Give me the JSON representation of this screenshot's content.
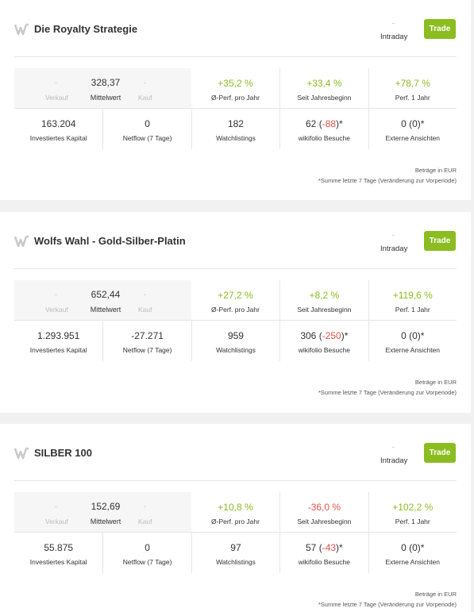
{
  "colors": {
    "accent": "#8bbc20",
    "negative": "#e0514e",
    "background": "#f1f1f1"
  },
  "icons": {
    "logo": "wikifolio-w-icon"
  },
  "cards": [
    {
      "name": "Die Royalty Strategie",
      "intraday_value": "-",
      "intraday_label": "Intraday",
      "trade_label": "Trade",
      "verkauf_value": "-",
      "verkauf_label": "Verkauf",
      "mittelwert_value": "328,37",
      "mittelwert_label": "Mittelwert",
      "kauf_value": "-",
      "kauf_label": "Kauf",
      "perf_year_value": "+35,2 %",
      "perf_year_label": "Ø-Perf. pro Jahr",
      "ytd_value": "+33,4 %",
      "ytd_label": "Seit Jahresbeginn",
      "perf1_value": "+78,7 %",
      "perf1_label": "Perf. 1 Jahr",
      "kapital_value": "163.204",
      "kapital_label": "Investiertes Kapital",
      "netflow_value": "0",
      "netflow_label": "Netflow (7 Tage)",
      "watch_value": "182",
      "watch_label": "Watchlistings",
      "besuche_value": "62",
      "besuche_change": "-88",
      "besuche_label": "wikifolio Besuche",
      "extern_value": "0",
      "extern_change": "0",
      "extern_label": "Externe Ansichten",
      "note1": "Beträge in EUR",
      "note2": "*Summe letzte 7 Tage (Veränderung zur Vorperiode)"
    },
    {
      "name": "Wolfs Wahl - Gold-Silber-Platin",
      "intraday_value": "-",
      "intraday_label": "Intraday",
      "trade_label": "Trade",
      "verkauf_value": "-",
      "verkauf_label": "Verkauf",
      "mittelwert_value": "652,44",
      "mittelwert_label": "Mittelwert",
      "kauf_value": "-",
      "kauf_label": "Kauf",
      "perf_year_value": "+27,2 %",
      "perf_year_label": "Ø-Perf. pro Jahr",
      "ytd_value": "+8,2 %",
      "ytd_label": "Seit Jahresbeginn",
      "perf1_value": "+119,6 %",
      "perf1_label": "Perf. 1 Jahr",
      "kapital_value": "1.293.951",
      "kapital_label": "Investiertes Kapital",
      "netflow_value": "-27.271",
      "netflow_label": "Netflow (7 Tage)",
      "watch_value": "959",
      "watch_label": "Watchlistings",
      "besuche_value": "306",
      "besuche_change": "-250",
      "besuche_label": "wikifolio Besuche",
      "extern_value": "0",
      "extern_change": "0",
      "extern_label": "Externe Ansichten",
      "note1": "Beträge in EUR",
      "note2": "*Summe letzte 7 Tage (Veränderung zur Vorperiode)"
    },
    {
      "name": "SILBER 100",
      "intraday_value": "-",
      "intraday_label": "Intraday",
      "trade_label": "Trade",
      "verkauf_value": "-",
      "verkauf_label": "Verkauf",
      "mittelwert_value": "152,69",
      "mittelwert_label": "Mittelwert",
      "kauf_value": "-",
      "kauf_label": "Kauf",
      "perf_year_value": "+10,8 %",
      "perf_year_label": "Ø-Perf. pro Jahr",
      "ytd_value": "-36,0 %",
      "ytd_label": "Seit Jahresbeginn",
      "perf1_value": "+102,2 %",
      "perf1_label": "Perf. 1 Jahr",
      "kapital_value": "55.875",
      "kapital_label": "Investiertes Kapital",
      "netflow_value": "0",
      "netflow_label": "Netflow (7 Tage)",
      "watch_value": "97",
      "watch_label": "Watchlistings",
      "besuche_value": "57",
      "besuche_change": "-43",
      "besuche_label": "wikifolio Besuche",
      "extern_value": "0",
      "extern_change": "0",
      "extern_label": "Externe Ansichten",
      "note1": "Beträge in EUR",
      "note2": "*Summe letzte 7 Tage (Veränderung zur Vorperiode)"
    }
  ]
}
